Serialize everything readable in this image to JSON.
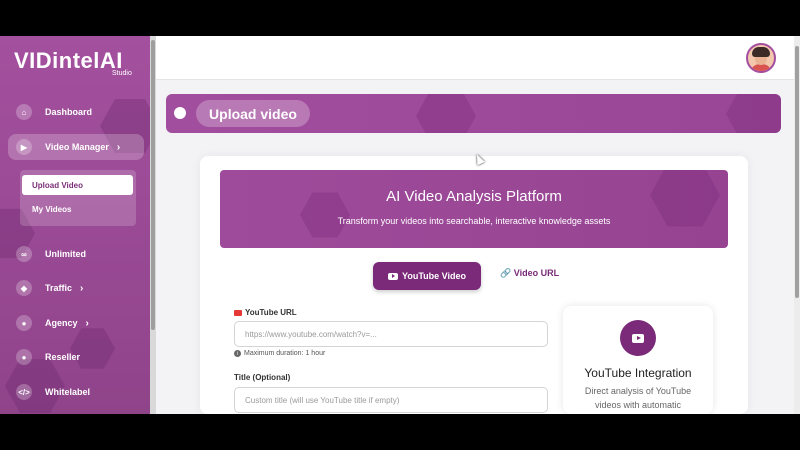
{
  "app": {
    "logo_text": "VIDintelAI",
    "logo_sub": "Studio"
  },
  "sidebar": {
    "items": [
      {
        "label": "Dashboard",
        "icon": "home-icon"
      },
      {
        "label": "Video Manager",
        "icon": "video-icon"
      },
      {
        "label": "Unlimited",
        "icon": "infinity-icon"
      },
      {
        "label": "Traffic",
        "icon": "shield-icon"
      },
      {
        "label": "Agency",
        "icon": "users-icon"
      },
      {
        "label": "Reseller",
        "icon": "user-icon"
      },
      {
        "label": "Whitelabel",
        "icon": "code-icon"
      }
    ],
    "sub_items": [
      {
        "label": "Upload Video"
      },
      {
        "label": "My Videos"
      }
    ]
  },
  "header": {
    "page_title": "Upload video"
  },
  "hero": {
    "title": "AI Video Analysis Platform",
    "subtitle": "Transform your videos into searchable, interactive knowledge assets"
  },
  "tabs": {
    "youtube": "YouTube Video",
    "url": "Video URL"
  },
  "form": {
    "youtube_url_label": "YouTube URL",
    "youtube_url_placeholder": "https://www.youtube.com/watch?v=...",
    "youtube_url_value": "",
    "duration_hint": "Maximum duration: 1 hour",
    "title_label": "Title (Optional)",
    "title_placeholder": "Custom title (will use YouTube title if empty)",
    "title_value": ""
  },
  "side_card": {
    "title": "YouTube Integration",
    "description": "Direct analysis of YouTube videos with automatic"
  },
  "colors": {
    "accent": "#7a2a78",
    "sidebar": "#9a4a95",
    "banner": "#a04c9c"
  }
}
